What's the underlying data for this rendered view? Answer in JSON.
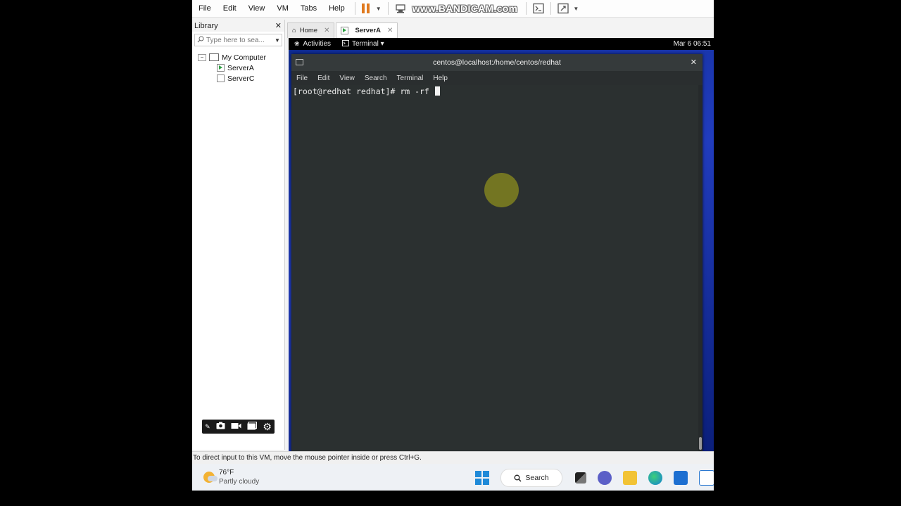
{
  "menubar": {
    "items": [
      "File",
      "Edit",
      "View",
      "VM",
      "Tabs",
      "Help"
    ],
    "watermark": "www.BANDICAM.com"
  },
  "library": {
    "title": "Library",
    "close_glyph": "✕",
    "search_placeholder": "Type here to sea...",
    "tree": {
      "root": "My Computer",
      "items": [
        "ServerA",
        "ServerC"
      ]
    }
  },
  "tabs": [
    {
      "label": "Home"
    },
    {
      "label": "ServerA",
      "active": true
    }
  ],
  "guest": {
    "activities": "Activities",
    "app_menu": "Terminal ▾",
    "clock": "Mar 6  06:51",
    "window_title": "centos@localhost:/home/centos/redhat",
    "window_menu": [
      "File",
      "Edit",
      "View",
      "Search",
      "Terminal",
      "Help"
    ],
    "prompt": "[root@redhat redhat]# rm -rf "
  },
  "statusbar": {
    "text": "To direct input to this VM, move the mouse pointer inside or press Ctrl+G."
  },
  "taskbar": {
    "temperature": "76°F",
    "condition": "Partly cloudy",
    "search_label": "Search"
  },
  "colors": {
    "pause_accent": "#e07a1f",
    "terminal_bg": "#2b3030",
    "guest_desktop": "#1a3aa0"
  }
}
